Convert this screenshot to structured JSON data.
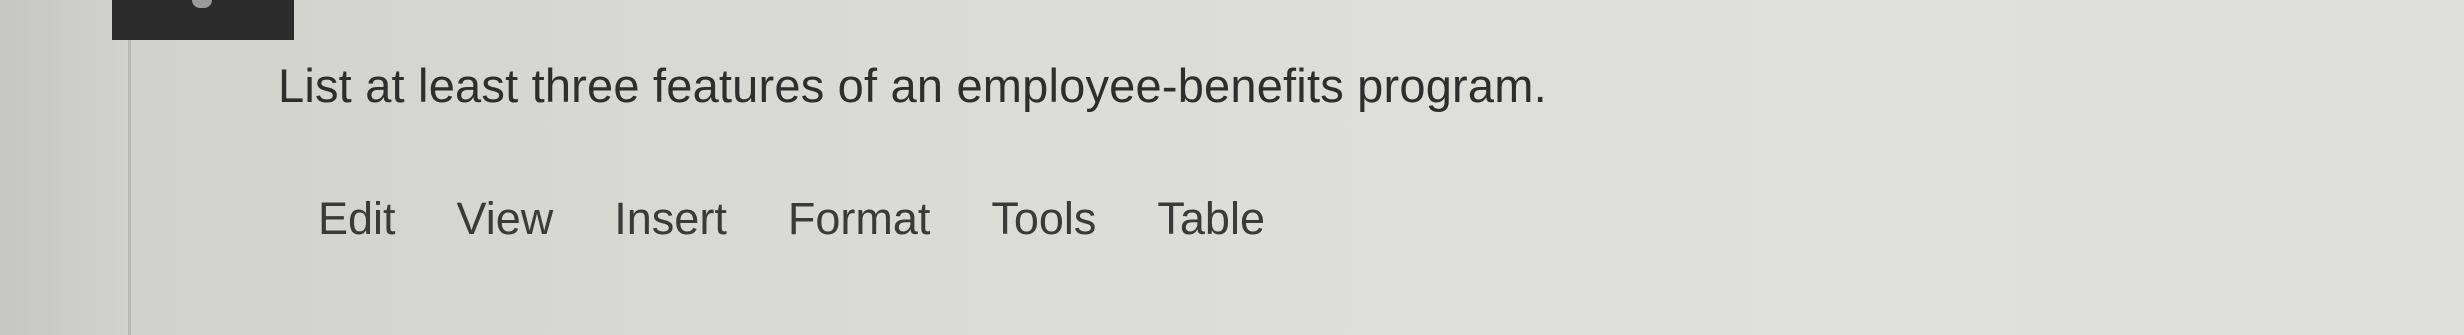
{
  "question": {
    "text": "List at least three features of an employee-benefits program."
  },
  "editor_menu": {
    "items": [
      {
        "label": "Edit"
      },
      {
        "label": "View"
      },
      {
        "label": "Insert"
      },
      {
        "label": "Format"
      },
      {
        "label": "Tools"
      },
      {
        "label": "Table"
      }
    ]
  },
  "colors": {
    "background": "#dcdcd8",
    "text": "#2e2e2e",
    "dark_tab": "#2b2b2b"
  }
}
